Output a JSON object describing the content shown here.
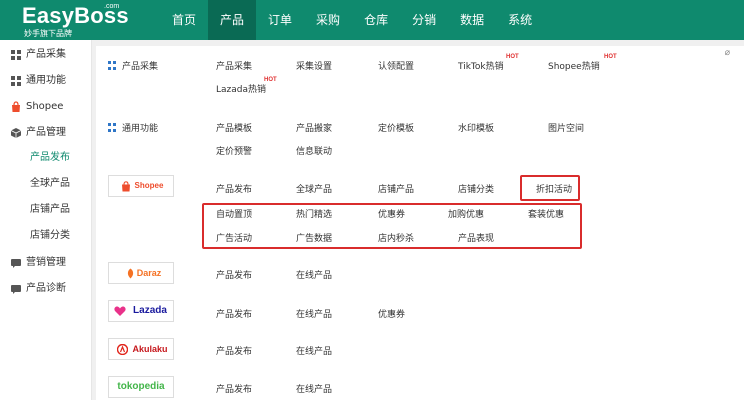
{
  "brand": {
    "name": "EasyBoss",
    "com": ".com",
    "slogan": "妙手旗下品牌"
  },
  "nav": [
    "首页",
    "产品",
    "订单",
    "采购",
    "仓库",
    "分销",
    "数据",
    "系统"
  ],
  "sidebar": {
    "items": [
      {
        "label": "产品采集"
      },
      {
        "label": "通用功能"
      },
      {
        "label": "Shopee"
      },
      {
        "label": "产品管理"
      }
    ],
    "subitems": [
      "产品发布",
      "全球产品",
      "店铺产品",
      "店铺分类"
    ],
    "bottom": [
      {
        "label": "营销管理"
      },
      {
        "label": "产品诊断"
      }
    ]
  },
  "main": {
    "categories": [
      {
        "label": "产品采集",
        "links": [
          "产品采集",
          "采集设置",
          "认领配置",
          "TikTok热销",
          "Shopee热销",
          "Lazada热销"
        ]
      },
      {
        "label": "通用功能",
        "links": [
          "产品模板",
          "产品搬家",
          "定价模板",
          "水印模板",
          "图片空间",
          "定价预警",
          "信息联动"
        ]
      }
    ],
    "hot": "HOT",
    "shopee": {
      "logo": "Shopee",
      "row1": [
        "产品发布",
        "全球产品",
        "店铺产品",
        "店铺分类",
        "折扣活动"
      ],
      "row2": [
        "自动置顶",
        "热门精选",
        "优惠券",
        "加购优惠",
        "套装优惠"
      ],
      "row3": [
        "广告活动",
        "广告数据",
        "店内秒杀",
        "产品表现"
      ]
    },
    "daraz": {
      "logo": "Daraz",
      "links": [
        "产品发布",
        "在线产品"
      ]
    },
    "lazada": {
      "logo": "Lazada",
      "links": [
        "产品发布",
        "在线产品",
        "优惠券"
      ]
    },
    "akulaku": {
      "logo": "Akulaku",
      "links": [
        "产品发布",
        "在线产品"
      ]
    },
    "tokopedia": {
      "logo": "tokopedia",
      "links": [
        "产品发布",
        "在线产品"
      ]
    }
  },
  "colors": {
    "brand": "#0f8a6e",
    "shopee": "#ee4d2d",
    "daraz": "#f57224",
    "lazada": "#1a1a9e",
    "akulaku": "#e1251b",
    "tokopedia": "#42b549",
    "highlight": "#d92c2c"
  }
}
